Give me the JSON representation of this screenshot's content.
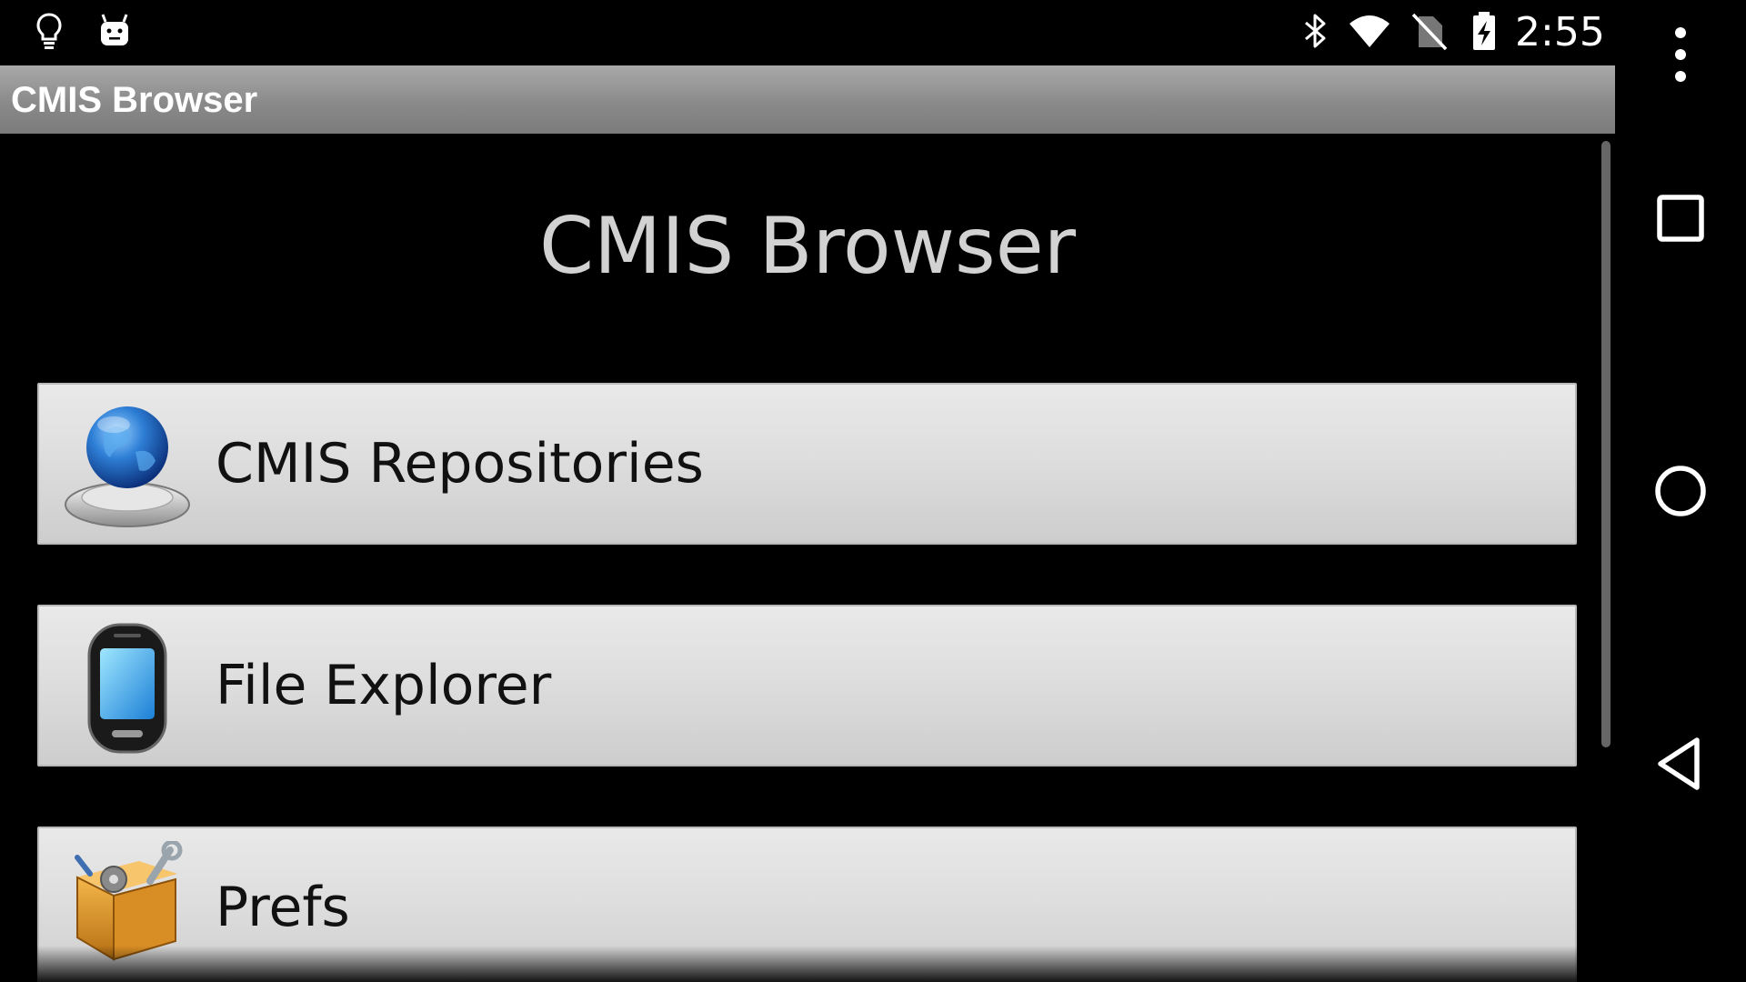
{
  "status_bar": {
    "time": "2:55",
    "left_icons": [
      "lightbulb-icon",
      "android-icon"
    ],
    "right_icons": [
      "bluetooth-icon",
      "wifi-icon",
      "no-sim-icon",
      "battery-charging-icon"
    ]
  },
  "title_bar": {
    "title": "CMIS Browser"
  },
  "main": {
    "heading": "CMIS Browser",
    "menu": [
      {
        "label": "CMIS Repositories",
        "icon": "globe-icon"
      },
      {
        "label": "File Explorer",
        "icon": "phone-icon"
      },
      {
        "label": "Prefs",
        "icon": "toolbox-icon"
      }
    ]
  },
  "nav_bar": {
    "buttons": [
      "overflow-menu-icon",
      "recents-icon",
      "home-icon",
      "back-icon"
    ]
  },
  "colors": {
    "background": "#000000",
    "title_bar": "#8a8a8a",
    "button_face": "#dedede",
    "heading_text": "#d2d2d2"
  }
}
